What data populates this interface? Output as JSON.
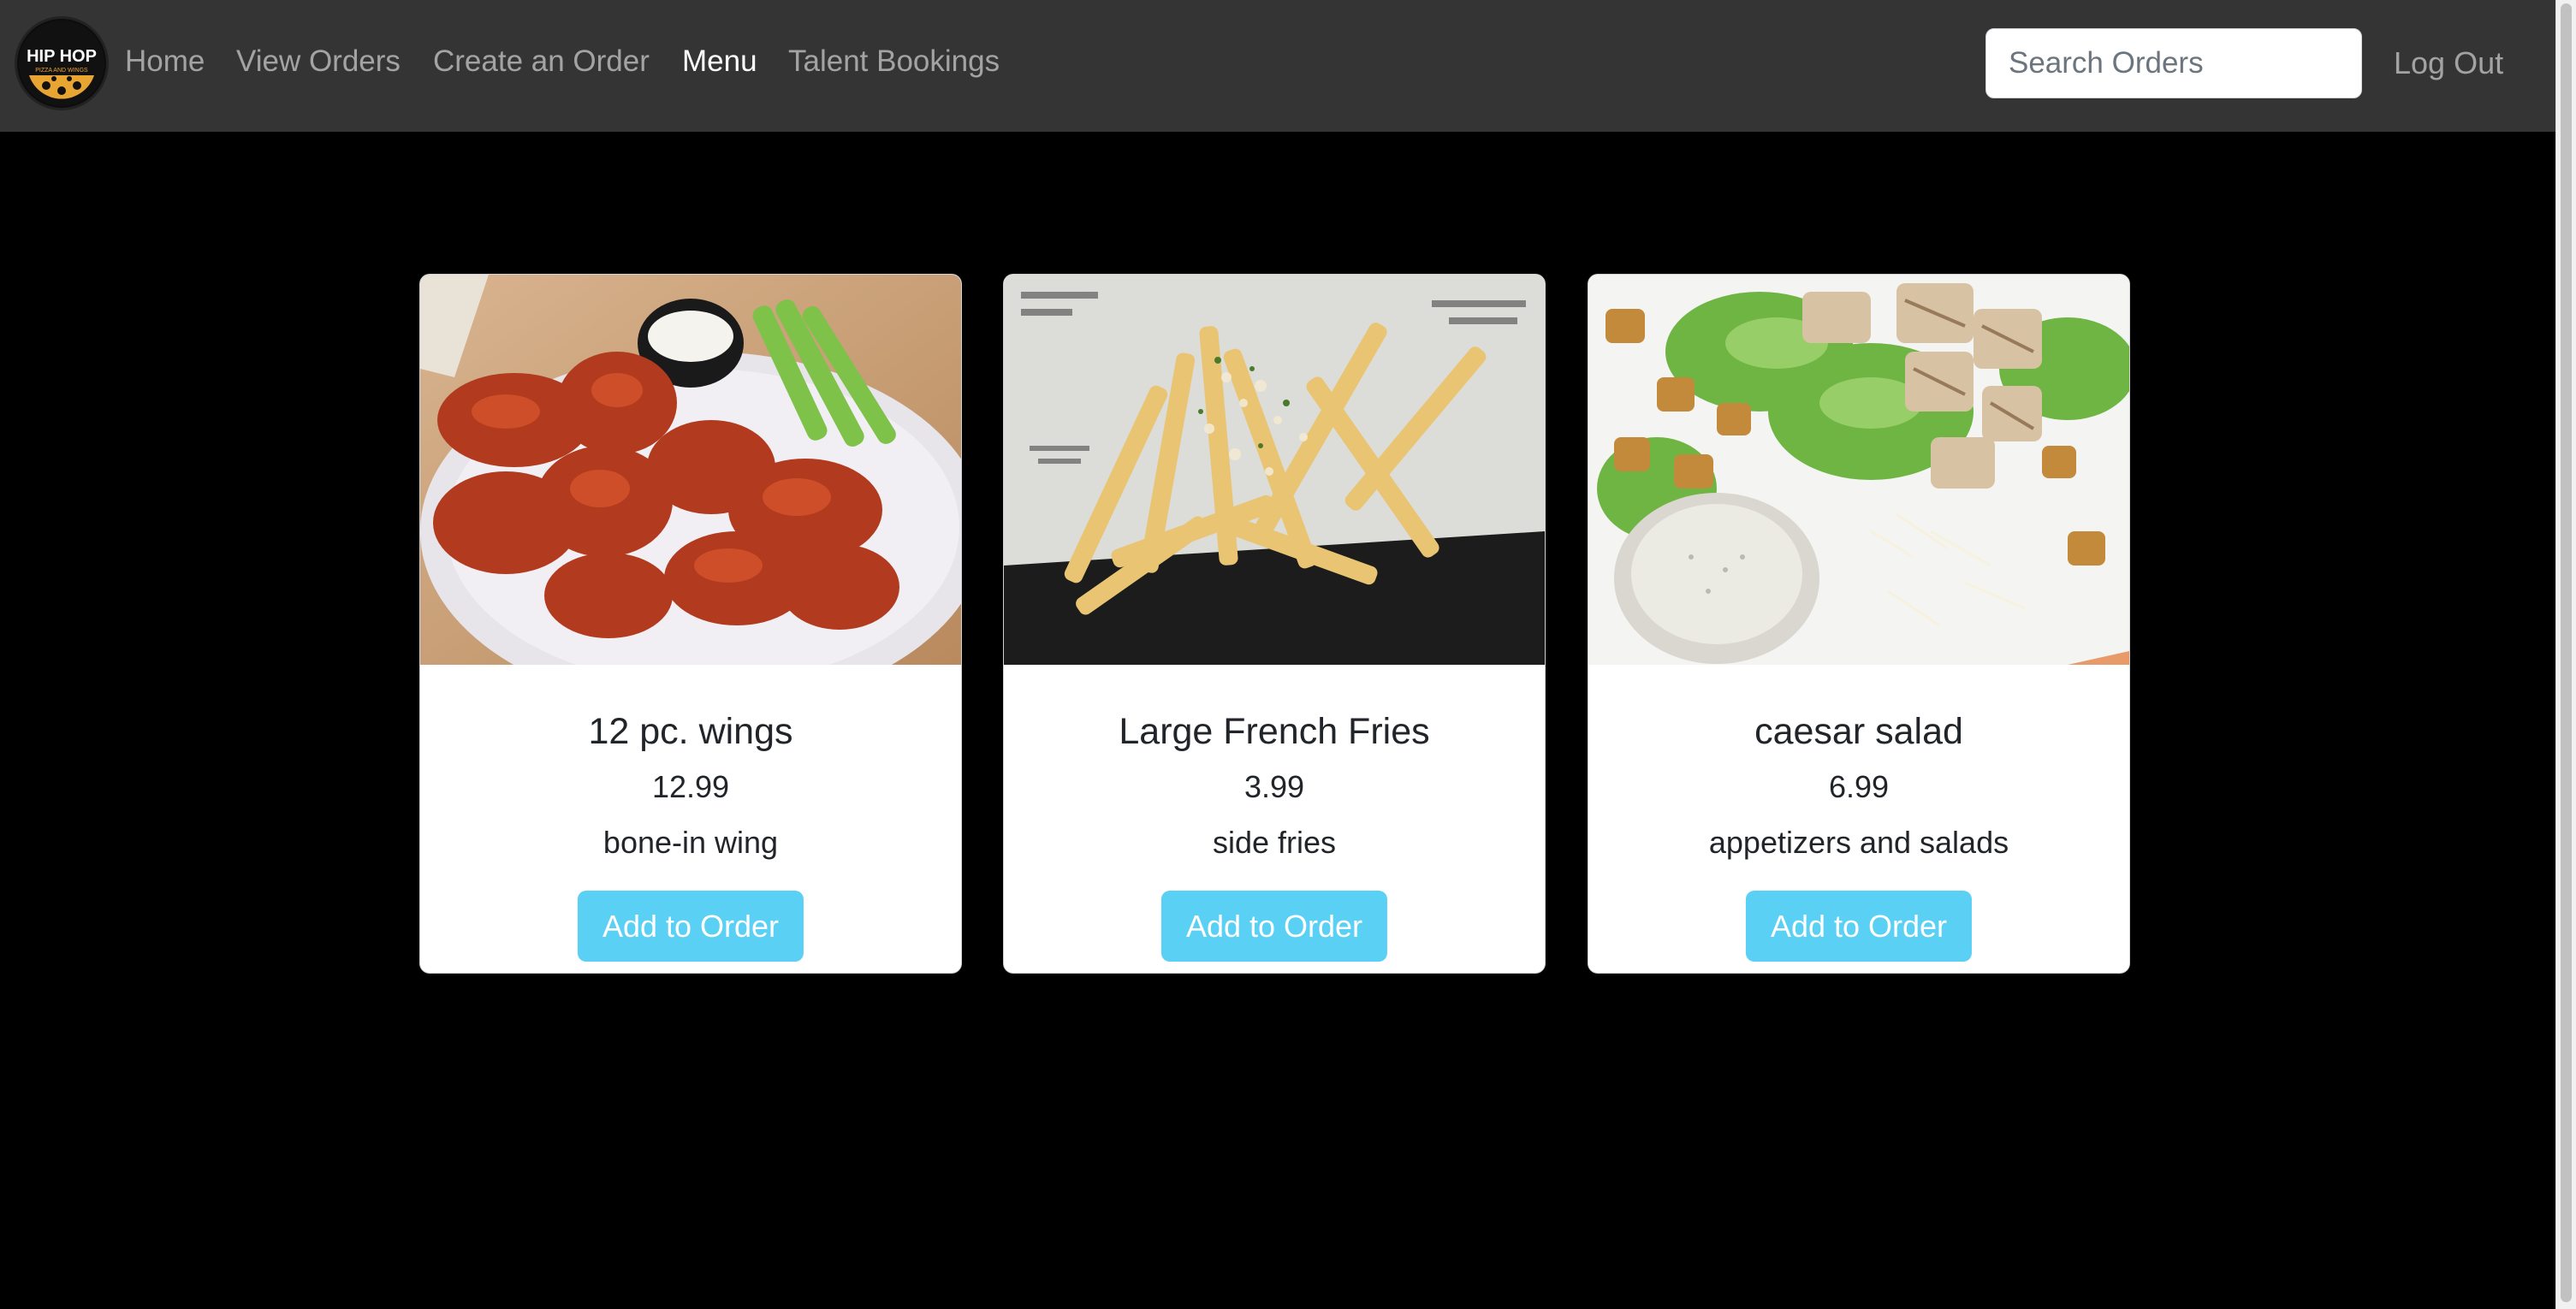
{
  "header": {
    "logo_text": "HIP HOP PIZZA AND WINGS",
    "nav": [
      {
        "label": "Home",
        "active": false
      },
      {
        "label": "View Orders",
        "active": false
      },
      {
        "label": "Create an Order",
        "active": false
      },
      {
        "label": "Menu",
        "active": true
      },
      {
        "label": "Talent Bookings",
        "active": false
      }
    ],
    "search_placeholder": "Search Orders",
    "logout_label": "Log Out"
  },
  "menu": {
    "items": [
      {
        "title": "12 pc. wings",
        "price": "12.99",
        "category": "bone-in wing",
        "button_label": "Add to Order",
        "image": "wings-photo"
      },
      {
        "title": "Large French Fries",
        "price": "3.99",
        "category": "side fries",
        "button_label": "Add to Order",
        "image": "fries-photo"
      },
      {
        "title": "caesar salad",
        "price": "6.99",
        "category": "appetizers and salads",
        "button_label": "Add to Order",
        "image": "salad-photo"
      }
    ]
  },
  "colors": {
    "navbar_bg": "#343434",
    "page_bg": "#000000",
    "button_bg": "#5bd0f5",
    "card_bg": "#ffffff"
  }
}
